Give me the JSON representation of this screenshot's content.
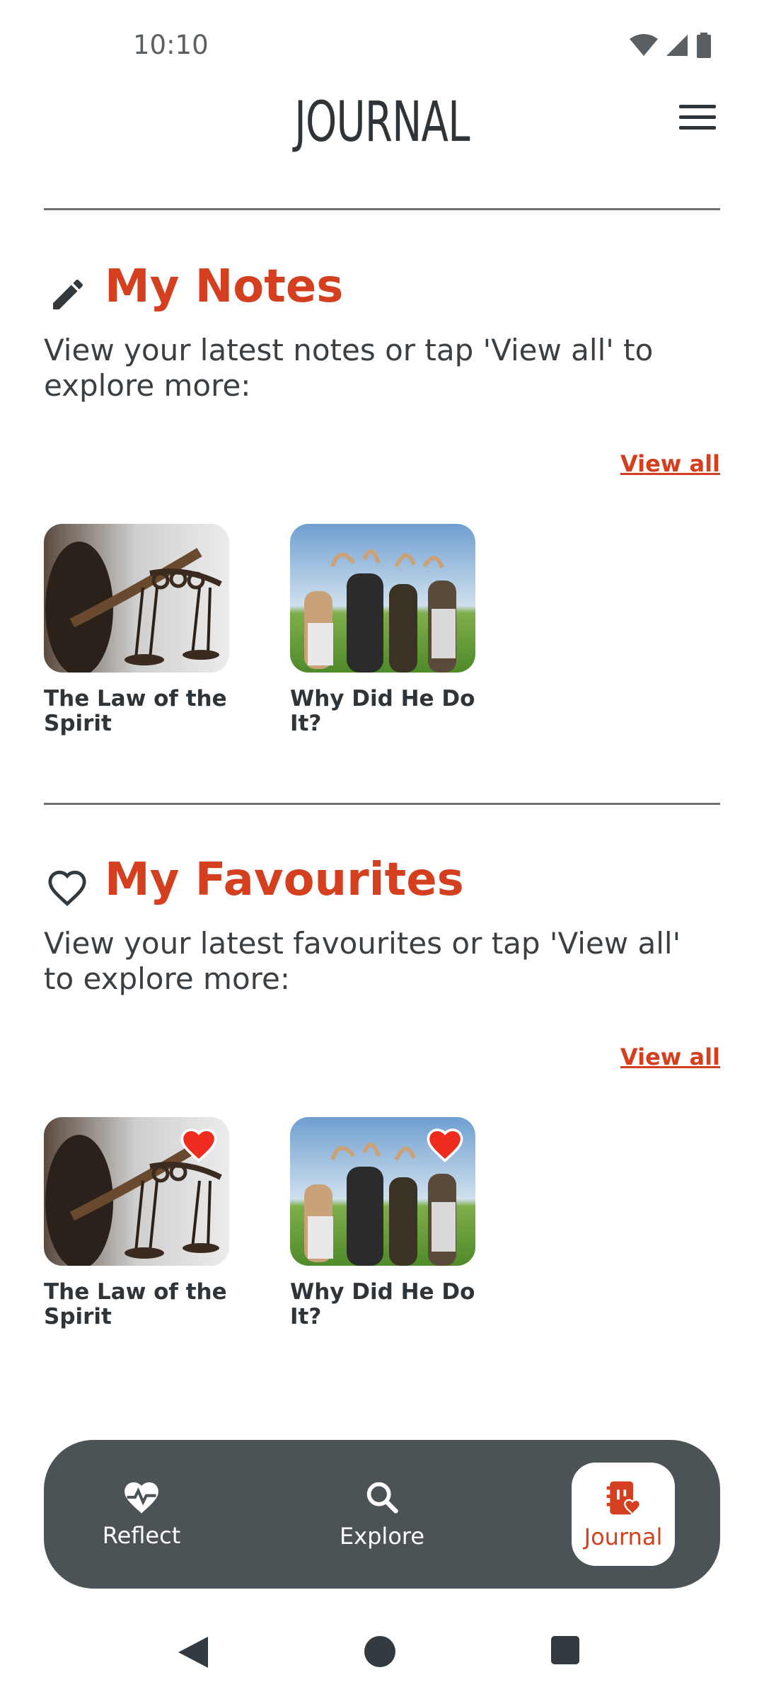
{
  "status": {
    "time": "10:10"
  },
  "header": {
    "title": "JOURNAL"
  },
  "notes": {
    "title": "My Notes",
    "description": "View your latest notes or tap 'View all' to explore more:",
    "view_all": "View all",
    "items": [
      {
        "title": "The Law of the Spirit"
      },
      {
        "title": "Why Did He Do It?"
      }
    ]
  },
  "favourites": {
    "title": "My Favourites",
    "description": "View your latest favourites or tap 'View all' to explore more:",
    "view_all": "View all",
    "items": [
      {
        "title": "The Law of the Spirit"
      },
      {
        "title": "Why Did He Do It?"
      }
    ]
  },
  "nav": {
    "items": [
      {
        "label": "Reflect",
        "icon": "heart-pulse-icon"
      },
      {
        "label": "Explore",
        "icon": "search-icon"
      },
      {
        "label": "Journal",
        "icon": "journal-icon",
        "active": true
      }
    ]
  },
  "colors": {
    "accent": "#d4401f",
    "nav_bg": "#4b5356",
    "text": "#2f3438"
  }
}
